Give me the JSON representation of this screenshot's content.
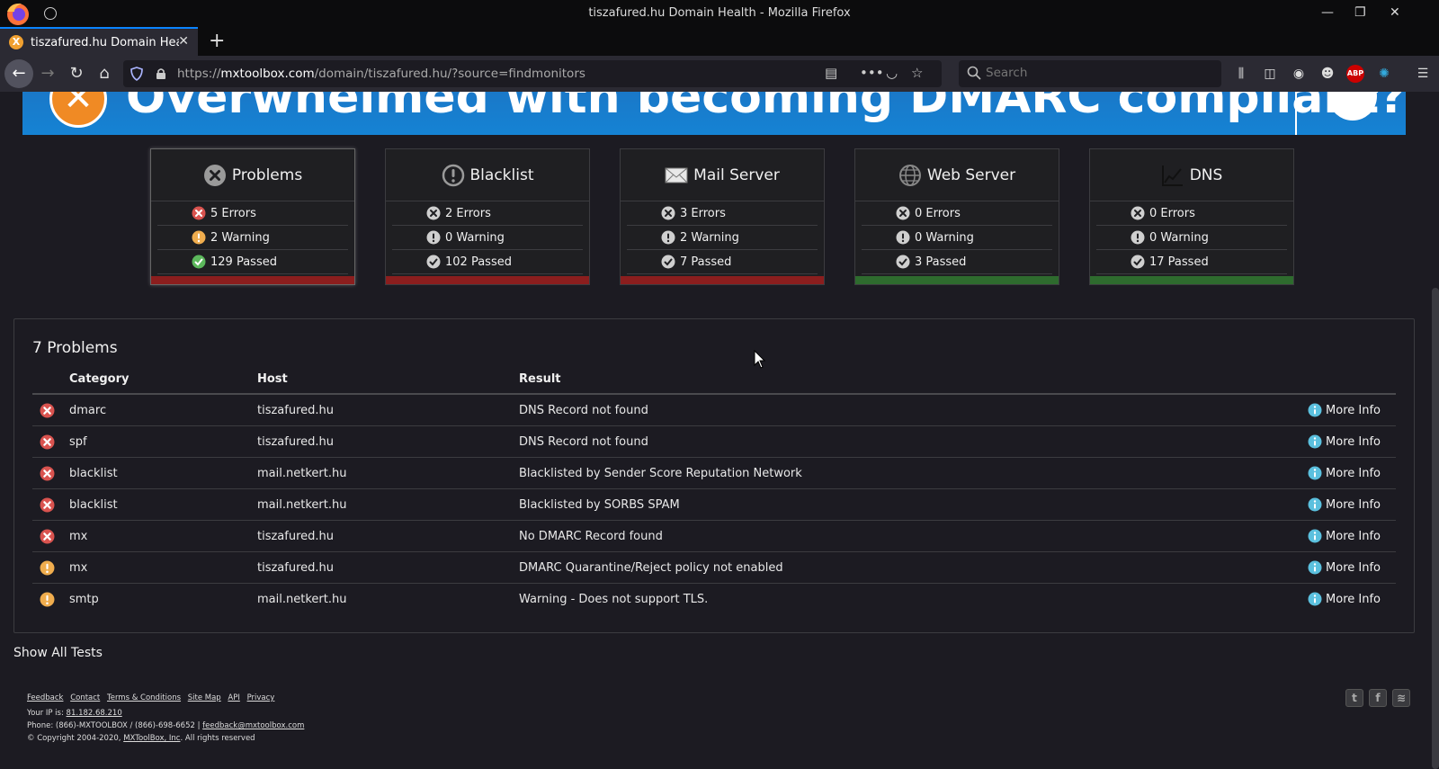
{
  "window": {
    "title": "tiszafured.hu Domain Health - Mozilla Firefox"
  },
  "tab": {
    "label": "tiszafured.hu Domain Hea",
    "favicon_letter": "X"
  },
  "urlbar": {
    "url_prefix": "https://",
    "url_domain": "mxtoolbox.com",
    "url_path": "/domain/tiszafured.hu/?source=findmonitors"
  },
  "search": {
    "placeholder": "Search"
  },
  "banner": {
    "text": "Overwhelmed with becoming DMARC compliant?"
  },
  "cards": [
    {
      "title": "Problems",
      "icon": "x-circle-icon",
      "errors": "5 Errors",
      "warning": "2 Warning",
      "passed": "129 Passed",
      "bar_color": "#8b1e1e"
    },
    {
      "title": "Blacklist",
      "icon": "exclamation-circle-icon",
      "errors": "2 Errors",
      "warning": "0 Warning",
      "passed": "102 Passed",
      "bar_color": "#8b1e1e"
    },
    {
      "title": "Mail Server",
      "icon": "envelope-icon",
      "errors": "3 Errors",
      "warning": "2 Warning",
      "passed": "7 Passed",
      "bar_color": "#8b1e1e"
    },
    {
      "title": "Web Server",
      "icon": "globe-icon",
      "errors": "0 Errors",
      "warning": "0 Warning",
      "passed": "3 Passed",
      "bar_color": "#2e6b2e"
    },
    {
      "title": "DNS",
      "icon": "chart-icon",
      "errors": "0 Errors",
      "warning": "0 Warning",
      "passed": "17 Passed",
      "bar_color": "#2e6b2e"
    }
  ],
  "problems": {
    "title": "7 Problems",
    "columns": [
      "Category",
      "Host",
      "Result"
    ],
    "more_info_label": "More Info",
    "rows": [
      {
        "status": "error",
        "category": "dmarc",
        "host": "tiszafured.hu",
        "result": "DNS Record not found"
      },
      {
        "status": "error",
        "category": "spf",
        "host": "tiszafured.hu",
        "result": "DNS Record not found"
      },
      {
        "status": "error",
        "category": "blacklist",
        "host": "mail.netkert.hu",
        "result": "Blacklisted by Sender Score Reputation Network"
      },
      {
        "status": "error",
        "category": "blacklist",
        "host": "mail.netkert.hu",
        "result": "Blacklisted by SORBS SPAM"
      },
      {
        "status": "error",
        "category": "mx",
        "host": "tiszafured.hu",
        "result": "No DMARC Record found"
      },
      {
        "status": "warning",
        "category": "mx",
        "host": "tiszafured.hu",
        "result": "DMARC Quarantine/Reject policy not enabled"
      },
      {
        "status": "warning",
        "category": "smtp",
        "host": "mail.netkert.hu",
        "result": "Warning - Does not support TLS."
      }
    ]
  },
  "show_all": "Show All Tests",
  "footer": {
    "links": [
      "Feedback",
      "Contact",
      "Terms & Conditions",
      "Site Map",
      "API",
      "Privacy"
    ],
    "ip_label": "Your IP is:",
    "ip": "81.182.68.210",
    "phone": "Phone: (866)-MXTOOLBOX / (866)-698-6652 |",
    "email": "feedback@mxtoolbox.com",
    "copyright_prefix": "© Copyright 2004-2020,",
    "company": "MXToolBox, Inc",
    "copyright_suffix": ". All rights reserved"
  },
  "colors": {
    "error": "#d9534f",
    "warning": "#f0ad4e",
    "passed": "#5cb85c",
    "info": "#5bc0de"
  }
}
